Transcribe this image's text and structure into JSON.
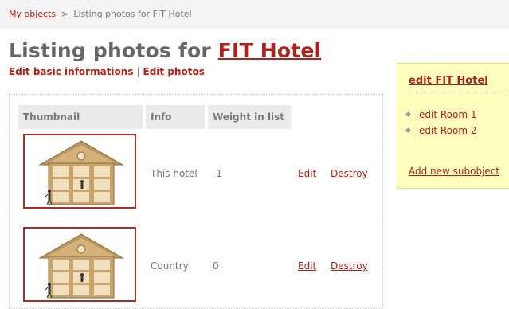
{
  "breadcrumb": {
    "root_label": "My objects",
    "separator": ">",
    "current": "Listing photos for FIT Hotel"
  },
  "header": {
    "title_prefix": "Listing photos for",
    "title_link": "FIT Hotel"
  },
  "subnav": {
    "edit_basic": "Edit basic informations",
    "separator": "|",
    "edit_photos": "Edit photos"
  },
  "table": {
    "columns": [
      "Thumbnail",
      "Info",
      "Weight in list"
    ],
    "rows": [
      {
        "thumbnail": "house-shelf-image",
        "info": "This hotel",
        "weight": "-1",
        "edit_label": "Edit",
        "destroy_label": "Destroy"
      },
      {
        "thumbnail": "house-shelf-image",
        "info": "Country",
        "weight": "0",
        "edit_label": "Edit",
        "destroy_label": "Destroy"
      }
    ]
  },
  "sidebar": {
    "title": "edit FIT Hotel",
    "items": [
      {
        "label": "edit Room 1"
      },
      {
        "label": "edit Room 2"
      }
    ],
    "add_label": "Add new subobject",
    "bullet_icon": "diamond-bullet-icon"
  },
  "colors": {
    "link": "#a8241d",
    "thumbnail_border": "#a8302a",
    "sidebar_bg": "#ffffbe",
    "header_bg": "#ebebeb"
  }
}
